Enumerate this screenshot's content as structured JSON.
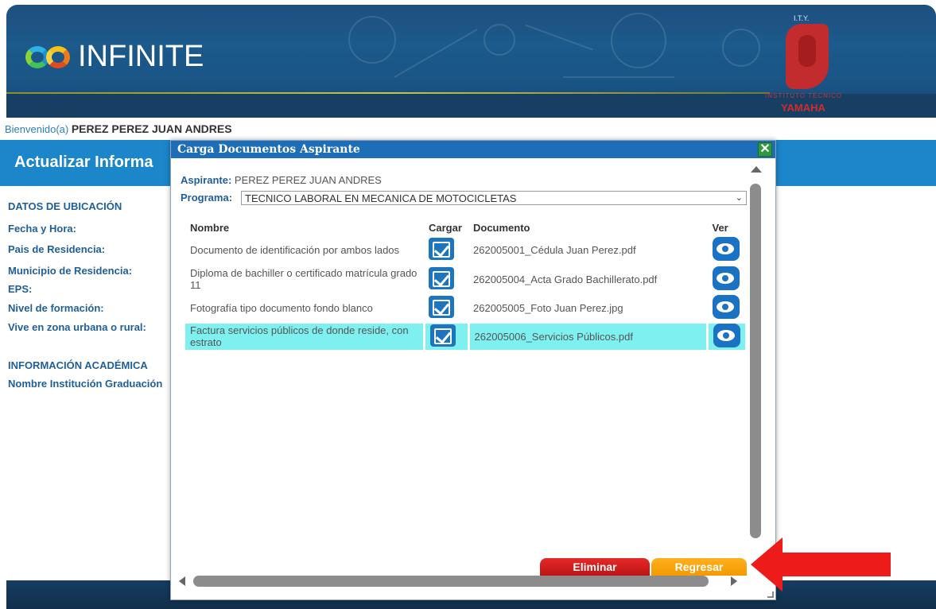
{
  "banner": {
    "logo_text": "INFINITE",
    "institution_label": "I.T.Y.",
    "institution_name": "INSTITUTO TÉCNICO",
    "brand": "YAMAHA"
  },
  "welcome": {
    "label": "Bienvenido(a)",
    "user_name": "PEREZ PEREZ JUAN ANDRES"
  },
  "page": {
    "section_title": "Actualizar Informa",
    "fields": [
      "DATOS DE UBICACIÓN",
      "Fecha y Hora:",
      "Pais de Residencia:",
      "Municipio de Residencia:",
      "EPS:",
      "Nivel de formación:",
      "Vive en zona urbana o rural:",
      "INFORMACIÓN ACADÉMICA",
      "Nombre Institución Graduación"
    ]
  },
  "modal": {
    "title": "Carga Documentos Aspirante",
    "close_symbol": "✕",
    "aspirante_label": "Aspirante:",
    "aspirante_value": "PEREZ PEREZ JUAN ANDRES",
    "programa_label": "Programa:",
    "programa_value": "TECNICO LABORAL EN MECANICA DE MOTOCICLETAS",
    "columns": {
      "nombre": "Nombre",
      "cargar": "Cargar",
      "documento": "Documento",
      "ver": "Ver"
    },
    "rows": [
      {
        "nombre": "Documento de identificación por ambos lados",
        "documento": "262005001_Cédula Juan Perez.pdf",
        "selected": false
      },
      {
        "nombre": "Diploma de bachiller o certificado matrícula grado 11",
        "documento": "262005004_Acta Grado Bachillerato.pdf",
        "selected": false
      },
      {
        "nombre": "Fotografía tipo documento fondo blanco",
        "documento": "262005005_Foto Juan Perez.jpg",
        "selected": false
      },
      {
        "nombre": "Factura servicios públicos de donde reside, con estrato",
        "documento": "262005006_Servicios Públicos.pdf",
        "selected": true
      }
    ],
    "buttons": {
      "eliminar": "Eliminar",
      "regresar": "Regresar"
    }
  },
  "colors": {
    "header_blue": "#1d6eb6",
    "selected_row": "#7ff0f0",
    "eliminar_red": "#d11f1f",
    "regresar_orange": "#f5a20f",
    "annotation_arrow": "#ee1b1b"
  }
}
